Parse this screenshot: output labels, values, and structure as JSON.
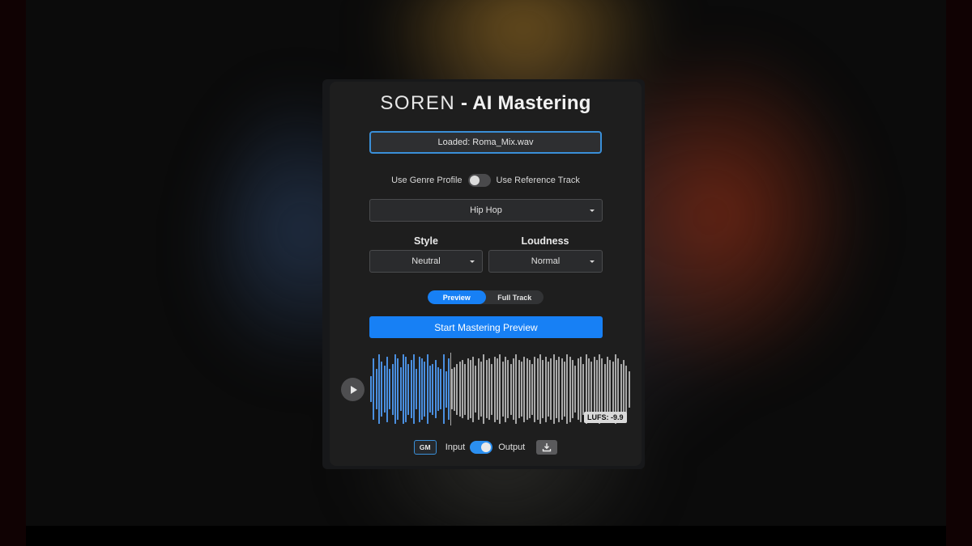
{
  "app": {
    "brand": "SOREN",
    "title_rest": " - AI Mastering"
  },
  "file": {
    "status_label": "Loaded: Roma_Mix.wav"
  },
  "mode_toggle": {
    "left_label": "Use Genre Profile",
    "right_label": "Use Reference Track",
    "state": "genre-profile"
  },
  "genre": {
    "selected": "Hip Hop"
  },
  "style": {
    "label": "Style",
    "selected": "Neutral"
  },
  "loudness": {
    "label": "Loudness",
    "selected": "Normal"
  },
  "render_mode": {
    "options": [
      "Preview",
      "Full Track"
    ],
    "active": "Preview"
  },
  "actions": {
    "start_label": "Start Mastering Preview"
  },
  "player": {
    "play_icon": "play-icon",
    "playhead_fraction": 0.31,
    "lufs_label": "LUFS: -9.9",
    "colors": {
      "played": "#4a8fe0",
      "unplayed": "#a9a9a9"
    },
    "amplitudes": [
      0.35,
      0.85,
      0.55,
      0.95,
      0.75,
      0.65,
      0.9,
      0.55,
      0.7,
      0.95,
      0.85,
      0.6,
      0.95,
      0.9,
      0.7,
      0.8,
      0.95,
      0.55,
      0.9,
      0.85,
      0.75,
      0.95,
      0.65,
      0.7,
      0.8,
      0.6,
      0.55,
      0.95,
      0.5,
      0.85,
      0.55,
      0.6,
      0.7,
      0.75,
      0.8,
      0.7,
      0.85,
      0.8,
      0.9,
      0.65,
      0.85,
      0.75,
      0.95,
      0.8,
      0.85,
      0.7,
      0.9,
      0.85,
      0.95,
      0.75,
      0.9,
      0.8,
      0.7,
      0.85,
      0.95,
      0.8,
      0.75,
      0.9,
      0.85,
      0.8,
      0.7,
      0.9,
      0.85,
      0.95,
      0.8,
      0.9,
      0.75,
      0.85,
      0.95,
      0.8,
      0.9,
      0.85,
      0.75,
      0.95,
      0.9,
      0.8,
      0.65,
      0.85,
      0.9,
      0.7,
      0.95,
      0.85,
      0.75,
      0.9,
      0.8,
      0.95,
      0.85,
      0.7,
      0.9,
      0.8,
      0.75,
      0.95,
      0.85,
      0.7,
      0.8,
      0.65,
      0.5
    ]
  },
  "output_controls": {
    "gm_label": "GM",
    "input_label": "Input",
    "output_label": "Output",
    "monitor_state": "output",
    "download_icon": "download-icon"
  }
}
